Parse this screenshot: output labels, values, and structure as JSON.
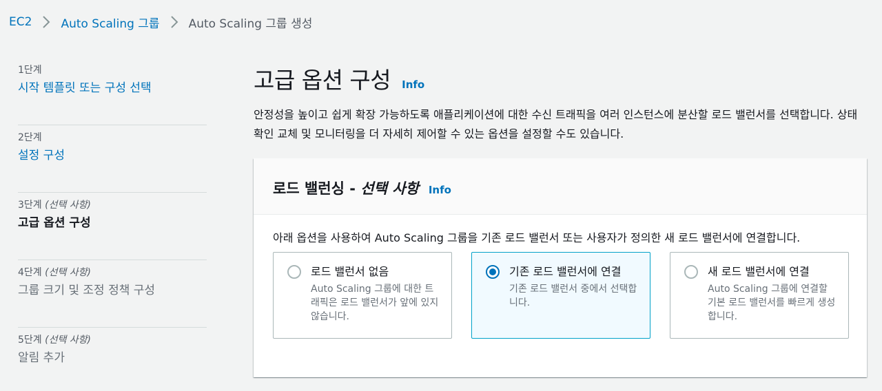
{
  "breadcrumb": {
    "items": [
      {
        "label": "EC2"
      },
      {
        "label": "Auto Scaling 그룹"
      },
      {
        "label": "Auto Scaling 그룹 생성"
      }
    ]
  },
  "steps": [
    {
      "step": "1단계",
      "optional": "",
      "title": "시작 템플릿 또는 구성 선택",
      "state": "link"
    },
    {
      "step": "2단계",
      "optional": "",
      "title": "설정 구성",
      "state": "link"
    },
    {
      "step": "3단계",
      "optional": "(선택 사항)",
      "title": "고급 옵션 구성",
      "state": "current"
    },
    {
      "step": "4단계",
      "optional": "(선택 사항)",
      "title": "그룹 크기 및 조정 정책 구성",
      "state": "disabled"
    },
    {
      "step": "5단계",
      "optional": "(선택 사항)",
      "title": "알림 추가",
      "state": "disabled"
    }
  ],
  "main": {
    "title": "고급 옵션 구성",
    "info": "Info",
    "description": "안정성을 높이고 쉽게 확장 가능하도록 애플리케이션에 대한 수신 트래픽을 여러 인스턴스에 분산할 로드 밸런서를 선택합니다. 상태 확인 교체 및 모니터링을 더 자세히 제어할 수 있는 옵션을 설정할 수도 있습니다."
  },
  "load_balancing": {
    "title": "로드 밸런싱 - ",
    "title_optional": "선택 사항",
    "info": "Info",
    "description": "아래 옵션을 사용하여 Auto Scaling 그룹을 기존 로드 밸런서 또는 사용자가 정의한 새 로드 밸런서에 연결합니다.",
    "options": [
      {
        "label": "로드 밸런서 없음",
        "description": "Auto Scaling 그룹에 대한 트래픽은 로드 밸런서가 앞에 있지 않습니다.",
        "selected": false
      },
      {
        "label": "기존 로드 밸런서에 연결",
        "description": "기존 로드 밸런서 중에서 선택합니다.",
        "selected": true
      },
      {
        "label": "새 로드 밸런서에 연결",
        "description": "Auto Scaling 그룹에 연결할 기본 로드 밸런서를 빠르게 생성합니다.",
        "selected": false
      }
    ]
  },
  "colors": {
    "link": "#0073bb",
    "selected_border": "#00a1c9",
    "selected_bg": "#f1faff",
    "background": "#f2f3f3"
  }
}
